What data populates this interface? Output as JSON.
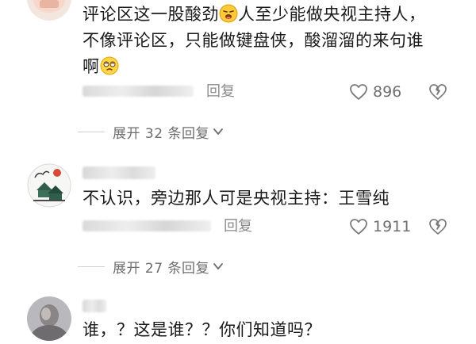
{
  "comments": [
    {
      "text_line1": "评论区这一股酸劲",
      "text_line1b": "人至少能做央视主持人，",
      "text_line2": "不像评论区，只能做键盘侠，酸溜溜的来句谁",
      "text_line3": "啊",
      "reply_label": "回复",
      "likes": "896",
      "expand_label": "展开 32 条回复"
    },
    {
      "text_line1": "不认识，旁边那人可是央视主持：王雪纯",
      "reply_label": "回复",
      "likes": "1911",
      "expand_label": "展开 27 条回复"
    },
    {
      "text_line1": "谁，？这是谁？？你们知道吗？"
    }
  ],
  "icons": {
    "like": "heart-outline-icon",
    "dislike": "broken-heart-icon",
    "expand": "chevron-down-icon"
  },
  "colors": {
    "text": "#1a1a1a",
    "muted": "#8a8a8a",
    "icon": "#7a7a7a"
  }
}
